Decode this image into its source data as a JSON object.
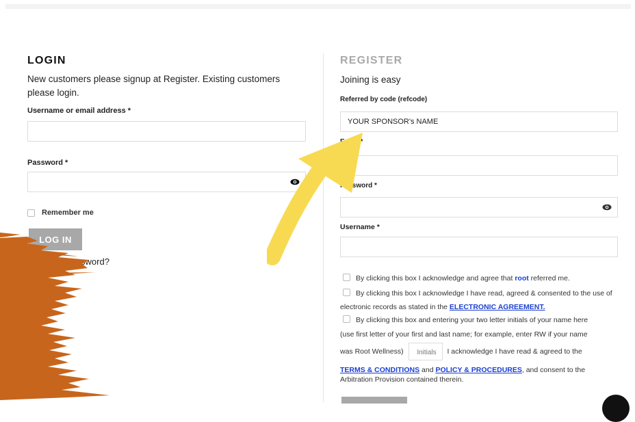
{
  "login": {
    "heading": "LOGIN",
    "intro": "New customers please signup at Register. Existing customers please login.",
    "username_label": "Username or email address *",
    "username_value": "",
    "password_label": "Password *",
    "password_value": "",
    "remember_label": "Remember me",
    "button_label": "LOG IN",
    "lost_password": "Lost your password?"
  },
  "register": {
    "heading": "REGISTER",
    "intro": "Joining is easy",
    "refcode_label": "Referred by code (refcode)",
    "refcode_value": "YOUR SPONSOR's NAME",
    "email_label": "Email *",
    "password_label": "Password *",
    "username_label": "Username *",
    "check1_prefix": "By clicking this box I acknowledge and agree that ",
    "check1_link": "root",
    "check1_suffix": " referred me.",
    "check2_prefix": "By clicking this box I acknowledge I have read, agreed & consented to the use of electronic records as stated in the ",
    "check2_link": "ELECTRONIC AGREEMENT.",
    "check3_line1": "By clicking this box and entering your two letter initials of your name here",
    "check3_line2": "(use first letter of your first and last name; for example, enter RW if your name",
    "check3_line3_prefix": "was Root Wellness)",
    "initials_placeholder": "Initials",
    "check3_line3_suffix": "I acknowledge I have read & agreed to the",
    "terms_link": "TERMS & CONDITIONS",
    "and_text": " and ",
    "policy_link": "POLICY & PROCEDURES",
    "terms_suffix": ", and consent to the Arbitration Provision contained therein."
  },
  "colors": {
    "accent_link": "#1a3fd1",
    "button_gray": "#a8a8a8",
    "arrow_yellow": "#f7da52",
    "brush_orange": "#c8651c"
  }
}
